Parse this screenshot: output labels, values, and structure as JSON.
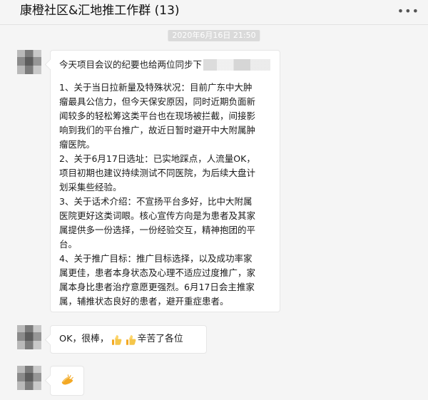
{
  "window": {
    "title": "康橙社区&汇地推工作群 (13)",
    "more_icon": "more-horizontal-icon"
  },
  "timestamp": "2020年6月16日 21:50",
  "messages": [
    {
      "first_line": "今天项目会议的纪要也给两位同步下",
      "paragraphs": [
        "1、关于当日拉新量及特殊状况：目前广东中大肿\n瘤最具公信力，但今天保安原因，同时近期负面新\n闻较多的轻松筹这类平台也在现场被拦截，间接影\n响到我们的平台推广，故近日暂时避开中大附属肿\n瘤医院。\n2、关于6月17日选址：已实地踩点，人流量OK，\n项目初期也建议持续测试不同医院，为后续大盘计\n划采集些经验。\n3、关于话术介绍：不宣扬平台多好，比中大附属\n医院更好这类词眼。核心宣传方向是为患者及其家\n属提供多一份选择，一份经验交互，精神抱团的平\n台。\n4、关于推广目标：推广目标选择，以及成功率家\n属更佳，患者本身状态及心理不适应过度推广，家\n属本身比患者治疗意愿更强烈。6月17日会主推家\n属，辅推状态良好的患者，避开重症患者。"
      ]
    },
    {
      "text_before": "OK，很棒，",
      "icons": [
        "thumbs-up-icon",
        "thumbs-up-icon"
      ],
      "text_after": "辛苦了各位"
    },
    {
      "icons": [
        "clap-icon"
      ]
    }
  ],
  "colors": {
    "background": "#f5f5f5",
    "bubble": "#ffffff",
    "border": "#e6e6e6",
    "timestamp_bg": "#dadada",
    "thumb_yellow": "#f3a824"
  }
}
